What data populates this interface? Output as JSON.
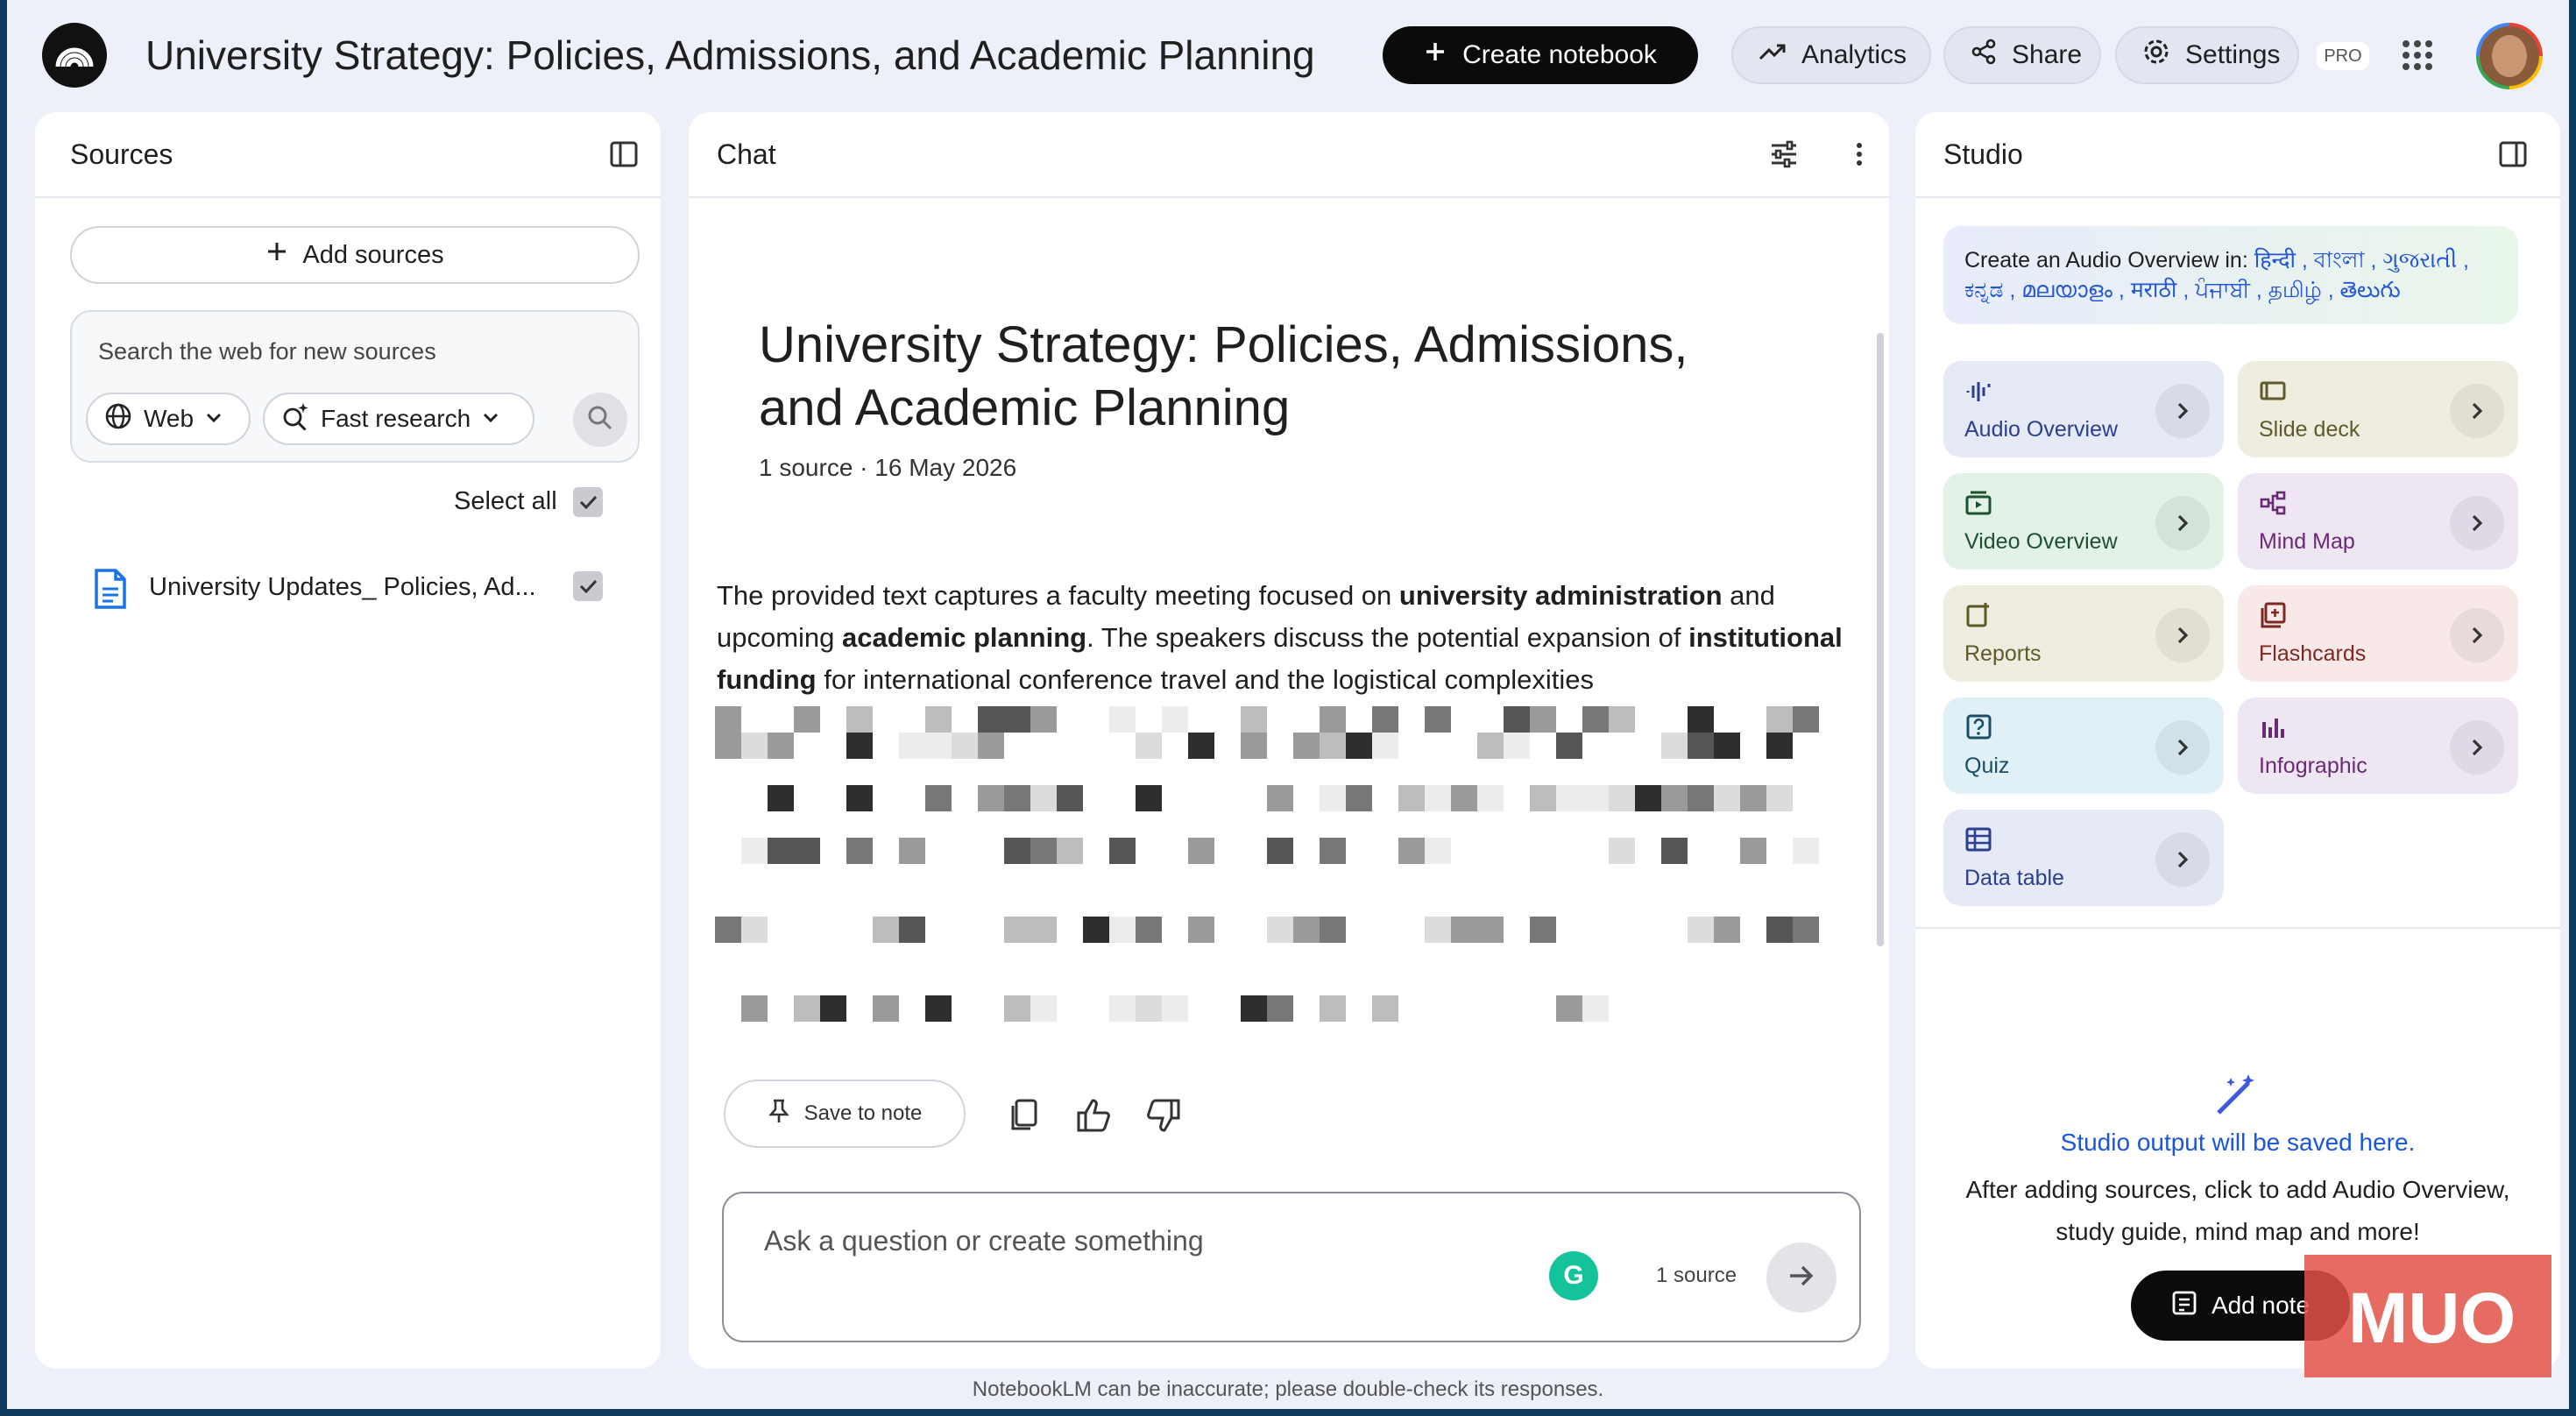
{
  "header": {
    "title": "University Strategy: Policies, Admissions, and Academic Planning",
    "create_label": "Create notebook",
    "analytics_label": "Analytics",
    "share_label": "Share",
    "settings_label": "Settings",
    "pro_badge": "PRO"
  },
  "sources": {
    "title": "Sources",
    "add_label": "Add sources",
    "search_placeholder": "Search the web for new sources",
    "web_chip": "Web",
    "fast_research_chip": "Fast research",
    "select_all_label": "Select all",
    "items": [
      {
        "title": "University Updates_ Policies, Ad...",
        "checked": true
      }
    ]
  },
  "chat": {
    "title": "Chat",
    "notebook_title": "University Strategy: Policies, Admissions, and Academic Planning",
    "meta": "1 source · 16 May 2026",
    "summary_parts": [
      "The provided text captures a faculty meeting focused on ",
      "university administration",
      " and upcoming ",
      "academic planning",
      ". The speakers discuss the potential expansion of ",
      "institutional funding",
      " for international conference travel and the logistical complexities"
    ],
    "save_note_label": "Save to note",
    "ask_placeholder": "Ask a question or create something",
    "source_count": "1 source"
  },
  "studio": {
    "title": "Studio",
    "audio_prompt": "Create an Audio Overview in:",
    "languages_line1": "हिन्दी , বাংলা , ગુજરાતી ,",
    "languages_line2": "ಕನ್ನಡ , മലയാളം , मराठी , ਪੰਜਾਬੀ , தமிழ் , తెలుగు",
    "tiles": [
      {
        "label": "Audio Overview",
        "icon": "audio-waveform-icon",
        "bg": "#e6e9f6",
        "color": "#2c3f8f"
      },
      {
        "label": "Slide deck",
        "icon": "slides-icon",
        "bg": "#eeede0",
        "color": "#5f5a2a"
      },
      {
        "label": "Video Overview",
        "icon": "video-icon",
        "bg": "#e2f2e6",
        "color": "#1f5130"
      },
      {
        "label": "Mind Map",
        "icon": "mind-map-icon",
        "bg": "#efe6f3",
        "color": "#6a2b76"
      },
      {
        "label": "Reports",
        "icon": "reports-icon",
        "bg": "#eeede0",
        "color": "#5f5a2a"
      },
      {
        "label": "Flashcards",
        "icon": "flashcards-icon",
        "bg": "#f8e8e8",
        "color": "#7a2a22"
      },
      {
        "label": "Quiz",
        "icon": "quiz-icon",
        "bg": "#dff0f7",
        "color": "#1c4d66"
      },
      {
        "label": "Infographic",
        "icon": "infographic-icon",
        "bg": "#efe6f3",
        "color": "#6a2b76"
      },
      {
        "label": "Data table",
        "icon": "data-table-icon",
        "bg": "#e6e9f6",
        "color": "#2c3f8f"
      }
    ],
    "empty_title": "Studio output will be saved here.",
    "empty_body": "After adding sources, click to add Audio Overview, study guide, mind map and more!",
    "add_note_label": "Add note"
  },
  "footer": {
    "disclaimer": "NotebookLM can be inaccurate; please double-check its responses."
  },
  "colors": {
    "accent_dark": "#0b0b0b",
    "link_blue": "#1a56db",
    "background": "#eef0f9"
  }
}
